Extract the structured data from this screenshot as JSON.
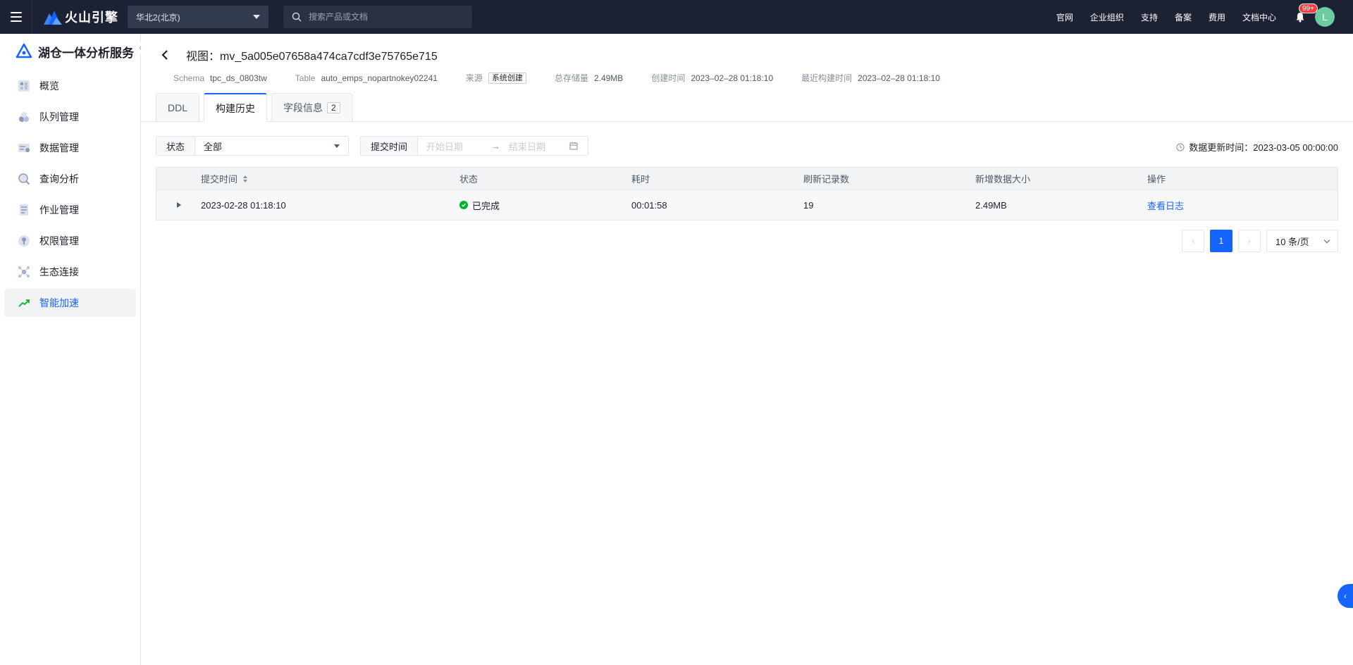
{
  "topbar": {
    "brand": "火山引擎",
    "region": "华北2(北京)",
    "search_placeholder": "搜索产品或文档",
    "links": [
      "官网",
      "企业组织",
      "支持",
      "备案",
      "费用",
      "文档中心"
    ],
    "notification_badge": "99+",
    "avatar_letter": "L"
  },
  "sidebar": {
    "title": "湖仓一体分析服务",
    "items": [
      {
        "label": "概览",
        "icon": "overview-icon"
      },
      {
        "label": "队列管理",
        "icon": "queue-icon"
      },
      {
        "label": "数据管理",
        "icon": "data-icon"
      },
      {
        "label": "查询分析",
        "icon": "query-icon"
      },
      {
        "label": "作业管理",
        "icon": "job-icon"
      },
      {
        "label": "权限管理",
        "icon": "permission-icon"
      },
      {
        "label": "生态连接",
        "icon": "ecosystem-icon"
      },
      {
        "label": "智能加速",
        "icon": "acceleration-icon",
        "active": true
      }
    ]
  },
  "page": {
    "title": "视图：mv_5a005e07658a474ca7cdf3e75765e715",
    "meta": {
      "schema_key": "Schema",
      "schema_val": "tpc_ds_0803tw",
      "table_key": "Table",
      "table_val": "auto_emps_nopartnokey02241",
      "source_key": "来源",
      "source_val": "系统创建",
      "storage_key": "总存储量",
      "storage_val": "2.49MB",
      "created_key": "创建时间",
      "created_val": "2023–02–28 01:18:10",
      "built_key": "最近构建时间",
      "built_val": "2023–02–28 01:18:10"
    },
    "tabs": [
      {
        "label": "DDL"
      },
      {
        "label": "构建历史",
        "active": true
      },
      {
        "label": "字段信息",
        "count": "2"
      }
    ]
  },
  "filters": {
    "status_label": "状态",
    "status_value": "全部",
    "time_label": "提交时间",
    "start_placeholder": "开始日期",
    "end_placeholder": "结束日期",
    "update_time": "数据更新时间：2023-03-05 00:00:00"
  },
  "table": {
    "headers": [
      "提交时间",
      "状态",
      "耗时",
      "刷新记录数",
      "新增数据大小",
      "操作"
    ],
    "rows": [
      {
        "submit_time": "2023-02-28 01:18:10",
        "status": "已完成",
        "duration": "00:01:58",
        "records": "19",
        "size": "2.49MB",
        "action": "查看日志"
      }
    ]
  },
  "pagination": {
    "current_page": "1",
    "page_size": "10 条/页"
  },
  "colors": {
    "accent": "#1664ff",
    "topbar_bg": "#1c2233",
    "success": "#00b42a"
  }
}
